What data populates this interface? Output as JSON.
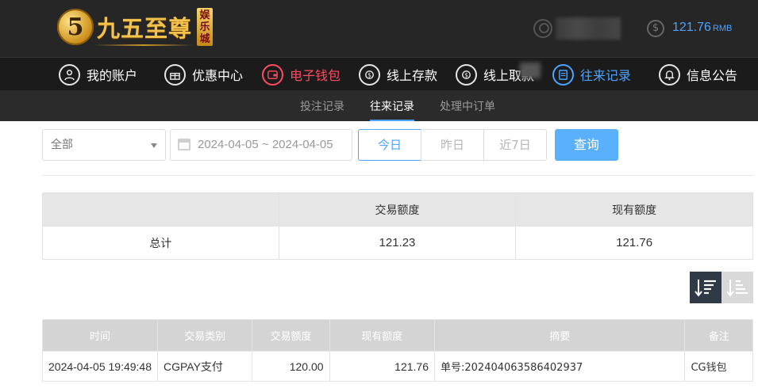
{
  "header": {
    "logo_badge": "5",
    "logo_text": "九五至尊",
    "logo_sub": [
      "娱",
      "乐",
      "城"
    ],
    "balance": "121.76",
    "currency": "RMB"
  },
  "main_nav": [
    {
      "label": "我的账户",
      "icon": "user-icon",
      "state": "normal"
    },
    {
      "label": "优惠中心",
      "icon": "gift-icon",
      "state": "normal"
    },
    {
      "label": "电子钱包",
      "icon": "wallet-icon",
      "state": "highlight-red"
    },
    {
      "label": "线上存款",
      "icon": "deposit-icon",
      "state": "normal"
    },
    {
      "label": "线上取款",
      "icon": "withdraw-icon",
      "state": "normal"
    },
    {
      "label": "往来记录",
      "icon": "records-icon",
      "state": "active"
    },
    {
      "label": "信息公告",
      "icon": "bell-icon",
      "state": "normal"
    }
  ],
  "sub_nav": [
    {
      "label": "投注记录",
      "active": false
    },
    {
      "label": "往来记录",
      "active": true
    },
    {
      "label": "处理中订单",
      "active": false
    }
  ],
  "filters": {
    "type_select": "全部",
    "date_range": "2024-04-05 ~ 2024-04-05",
    "quick": [
      "今日",
      "昨日",
      "近7日"
    ],
    "search_label": "查询"
  },
  "summary": {
    "headers": [
      "",
      "交易额度",
      "现有额度"
    ],
    "row": {
      "label": "总计",
      "amount": "121.23",
      "balance": "121.76"
    }
  },
  "records": {
    "headers": [
      "时间",
      "交易类别",
      "交易额度",
      "现有额度",
      "摘要",
      "备注"
    ],
    "rows": [
      {
        "time": "2024-04-05 19:49:48",
        "type": "CGPAY支付",
        "amount": "120.00",
        "balance": "121.76",
        "summary": "单号:202404063586402937",
        "note": "CG钱包"
      }
    ]
  },
  "colors": {
    "accent": "#4da3ff",
    "highlight_red": "#ff4b61",
    "header_bg": "#262626",
    "gold": "#f2c14e"
  }
}
